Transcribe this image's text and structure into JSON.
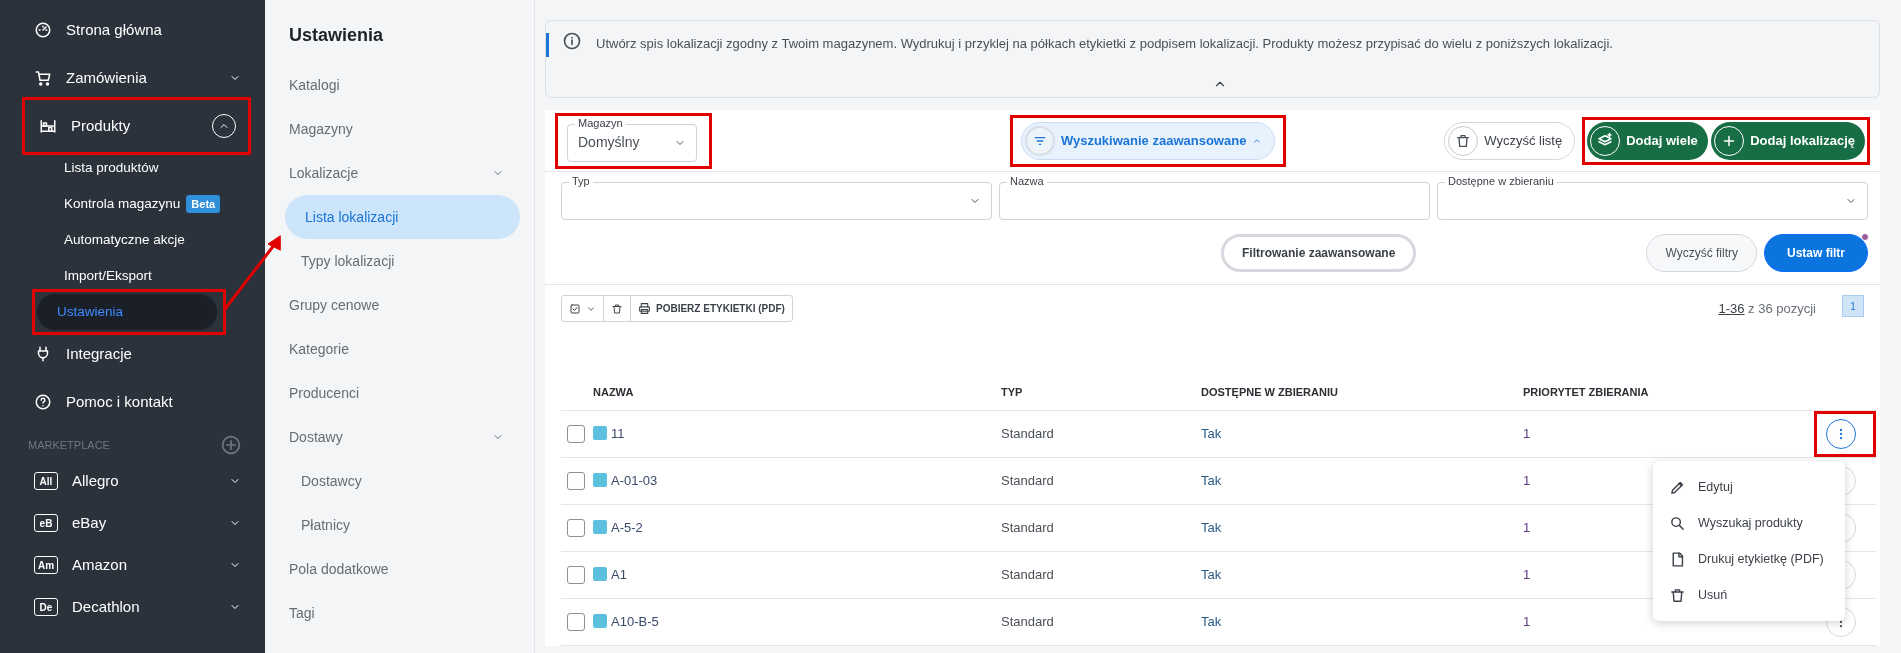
{
  "sidebar": {
    "items": [
      {
        "label": "Strona główna"
      },
      {
        "label": "Zamówienia",
        "expanded": false
      },
      {
        "label": "Produkty",
        "expanded": true,
        "highlighted": true,
        "children": [
          {
            "label": "Lista produktów",
            "selected": false
          },
          {
            "label": "Kontrola magazynu",
            "badge": "Beta",
            "selected": false
          },
          {
            "label": "Automatyczne akcje",
            "selected": false
          },
          {
            "label": "Import/Eksport",
            "selected": false
          },
          {
            "label": "Ustawienia",
            "selected": true,
            "highlighted": true
          }
        ]
      },
      {
        "label": "Integracje"
      },
      {
        "label": "Pomoc i kontakt"
      }
    ],
    "marketplace": {
      "heading": "MARKETPLACE",
      "items": [
        {
          "abbr": "All",
          "label": "Allegro",
          "expanded": false
        },
        {
          "abbr": "eB",
          "label": "eBay",
          "expanded": false
        },
        {
          "abbr": "Am",
          "label": "Amazon",
          "expanded": false
        },
        {
          "abbr": "De",
          "label": "Decathlon",
          "expanded": false
        }
      ]
    }
  },
  "annotation_arrow": true,
  "settings": {
    "title": "Ustawienia",
    "items": [
      {
        "label": "Katalogi",
        "selected": false
      },
      {
        "label": "Magazyny",
        "selected": false
      },
      {
        "label": "Lokalizacje",
        "selected": false,
        "expanded": true,
        "children": [
          {
            "label": "Lista lokalizacji",
            "selected": true
          },
          {
            "label": "Typy lokalizacji",
            "selected": false
          }
        ]
      },
      {
        "label": "Grupy cenowe",
        "selected": false
      },
      {
        "label": "Kategorie",
        "selected": false
      },
      {
        "label": "Producenci",
        "selected": false
      },
      {
        "label": "Dostawy",
        "selected": false,
        "expanded": true,
        "children": [
          {
            "label": "Dostawcy",
            "selected": false
          },
          {
            "label": "Płatnicy",
            "selected": false
          }
        ]
      },
      {
        "label": "Pola dodatkowe",
        "selected": false
      },
      {
        "label": "Tagi",
        "selected": false
      }
    ]
  },
  "info": {
    "text": "Utwórz spis lokalizacji zgodny z Twoim magazynem. Wydrukuj i przyklej na półkach etykietki z podpisem lokalizacji. Produkty możesz przypisać do wielu z poniższych lokalizacji.",
    "expanded": true
  },
  "toolbar": {
    "warehouse": {
      "label": "Magazyn",
      "value": "Domyślny",
      "highlighted": true
    },
    "advanced_search": {
      "label": "Wyszukiwanie zaawansowane",
      "expanded": true,
      "highlighted": true
    },
    "clear_list": "Wyczyść listę",
    "add_buttons": {
      "highlighted": true,
      "buttons": [
        "Dodaj wiele",
        "Dodaj lokalizację"
      ]
    }
  },
  "filters": {
    "fields": [
      {
        "label": "Typ",
        "kind": "select"
      },
      {
        "label": "Nazwa",
        "kind": "text"
      },
      {
        "label": "Dostępne w zbieraniu",
        "kind": "select"
      }
    ],
    "advanced_filter": "Filtrowanie zaawansowane",
    "clear": "Wyczyść filtry",
    "apply": "Ustaw filtr",
    "apply_notification": true
  },
  "table": {
    "print_button": "POBIERZ ETYKIETKI (PDF)",
    "range": "1-36",
    "total": "z 36 pozycji",
    "page": "1",
    "columns": [
      "NAZWA",
      "TYP",
      "DOSTĘPNE W ZBIERANIU",
      "PRIORYTET ZBIERANIA"
    ],
    "rows": [
      {
        "name": "11",
        "type": "Standard",
        "available": "Tak",
        "priority": "1",
        "checked": false,
        "menu_open": true
      },
      {
        "name": "A-01-03",
        "type": "Standard",
        "available": "Tak",
        "priority": "1",
        "checked": false,
        "menu_open": false
      },
      {
        "name": "A-5-2",
        "type": "Standard",
        "available": "Tak",
        "priority": "1",
        "checked": false,
        "menu_open": false
      },
      {
        "name": "A1",
        "type": "Standard",
        "available": "Tak",
        "priority": "1",
        "checked": false,
        "menu_open": false
      },
      {
        "name": "A10-B-5",
        "type": "Standard",
        "available": "Tak",
        "priority": "1",
        "checked": false,
        "menu_open": false
      }
    ]
  },
  "row_menu": {
    "items": [
      "Edytuj",
      "Wyszukaj produkty",
      "Drukuj etykietkę (PDF)",
      "Usuń"
    ]
  }
}
